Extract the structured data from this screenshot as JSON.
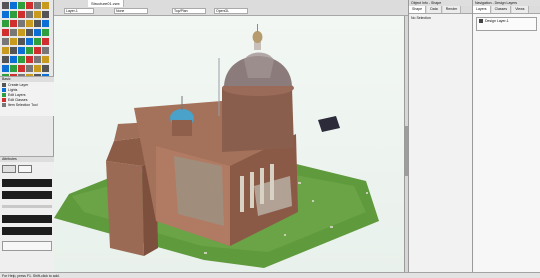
{
  "document": {
    "tab_label": "Structure01.vwx"
  },
  "viewport": {
    "layer_label": "Layer-1",
    "class_label": "None",
    "view_label": "Top/Plan",
    "render_label": "OpenGL",
    "status_hint": "Click to select an object. Shift-click to add to selection."
  },
  "left_palette": {
    "title": "Basic",
    "items": [
      "Create Layer",
      "Lights",
      "Edit Layers",
      "Edit Classes",
      "Item Selection Tool"
    ],
    "attributes_title": "Attributes"
  },
  "right_panel": {
    "title": "Object Info - Shape",
    "tabs": [
      "Shape",
      "Data",
      "Render"
    ],
    "selection_label": "No Selection"
  },
  "nav_panel": {
    "title": "Navigation - Design Layers",
    "tabs": [
      "Layers",
      "Classes",
      "Views"
    ],
    "items": [
      "Design Layer-1"
    ]
  },
  "status_bar": {
    "text": "For Help, press F1. Shift-click to add."
  }
}
